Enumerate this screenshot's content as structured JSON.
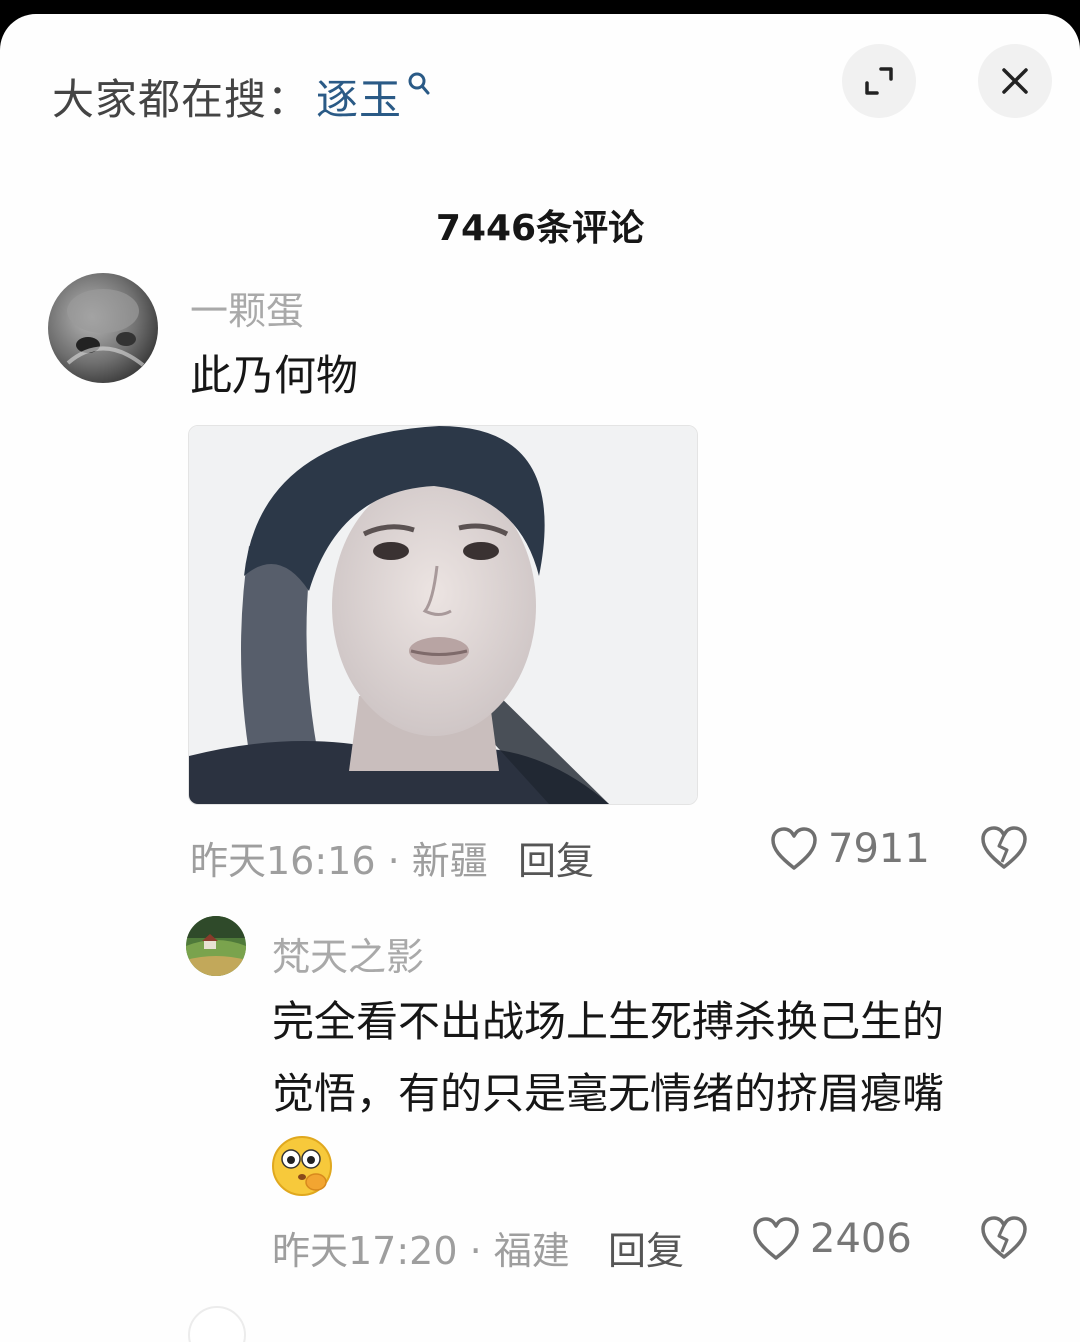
{
  "search": {
    "prefix": "大家都在搜：",
    "term": "逐玉"
  },
  "header": {
    "comment_count": "7446条评论"
  },
  "comments": [
    {
      "username": "一颗蛋",
      "text": "此乃何物",
      "time": "昨天16:16",
      "location": "新疆",
      "reply_label": "回复",
      "likes": "7911"
    }
  ],
  "replies": [
    {
      "username": "梵天之影",
      "text_line1": "完全看不出战场上生死搏杀换己生的",
      "text_line2": "觉悟，有的只是毫无情绪的挤眉瘪嘴",
      "time": "昨天17:20",
      "location": "福建",
      "reply_label": "回复",
      "likes": "2406"
    }
  ],
  "colors": {
    "search_term": "#2a5a86",
    "text": "#161616",
    "muted": "#9e9e9e"
  },
  "icons": [
    "search-icon",
    "expand-icon",
    "close-icon",
    "heart-icon",
    "broken-heart-icon",
    "emoji-icon"
  ]
}
